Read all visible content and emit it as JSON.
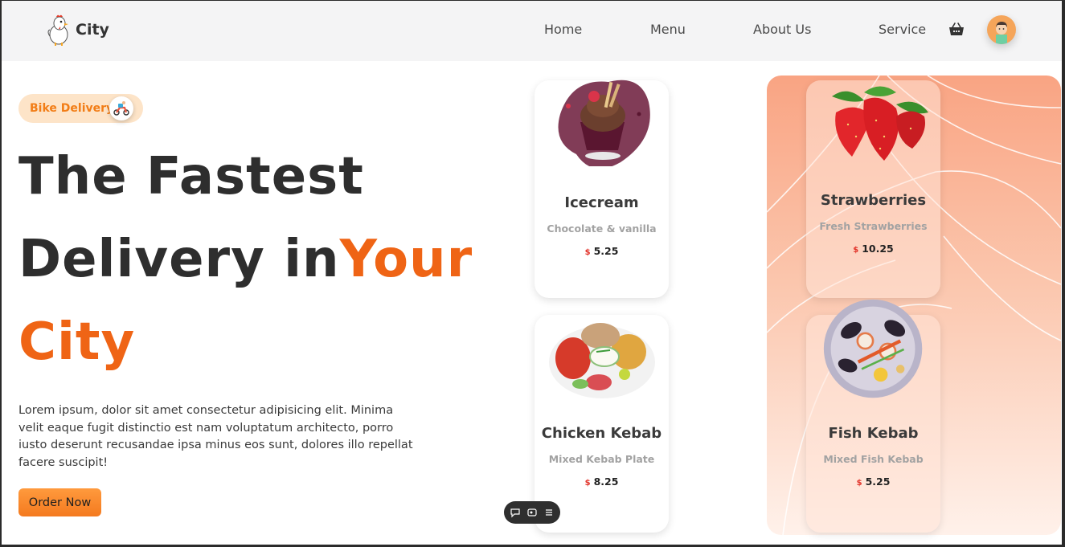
{
  "header": {
    "brand": "City",
    "nav": [
      "Home",
      "Menu",
      "About Us",
      "Service"
    ],
    "icons": {
      "cart": "basket-icon",
      "avatar": "user-avatar"
    }
  },
  "hero": {
    "badge": "Bike Delivery",
    "badge_icon": "scooter-icon",
    "title_line1": "The Fastest",
    "title_line2_a": "Delivery in",
    "title_line2_b": "Your",
    "title_line3": "City",
    "paragraph": "Lorem ipsum, dolor sit amet consectetur adipisicing elit. Minima velit eaque fugit distinctio est nam voluptatum architecto, porro iusto deserunt recusandae ipsa minus eos sunt, dolores illo repellat facere suscipit!",
    "cta": "Order Now"
  },
  "cards": [
    {
      "title": "Icecream",
      "subtitle": "Chocolate & vanilla",
      "currency": "$",
      "price": "5.25"
    },
    {
      "title": "Strawberries",
      "subtitle": "Fresh Strawberries",
      "currency": "$",
      "price": "10.25"
    },
    {
      "title": "Chicken Kebab",
      "subtitle": "Mixed Kebab Plate",
      "currency": "$",
      "price": "8.25"
    },
    {
      "title": "Fish Kebab",
      "subtitle": "Mixed Fish Kebab",
      "currency": "$",
      "price": "5.25"
    }
  ],
  "colors": {
    "accent": "#ef6415",
    "badge_bg": "#fde4c8",
    "panel_top": "#f9a483"
  },
  "toolbar_icons": [
    "comment-icon",
    "screen-icon",
    "menu-icon"
  ]
}
